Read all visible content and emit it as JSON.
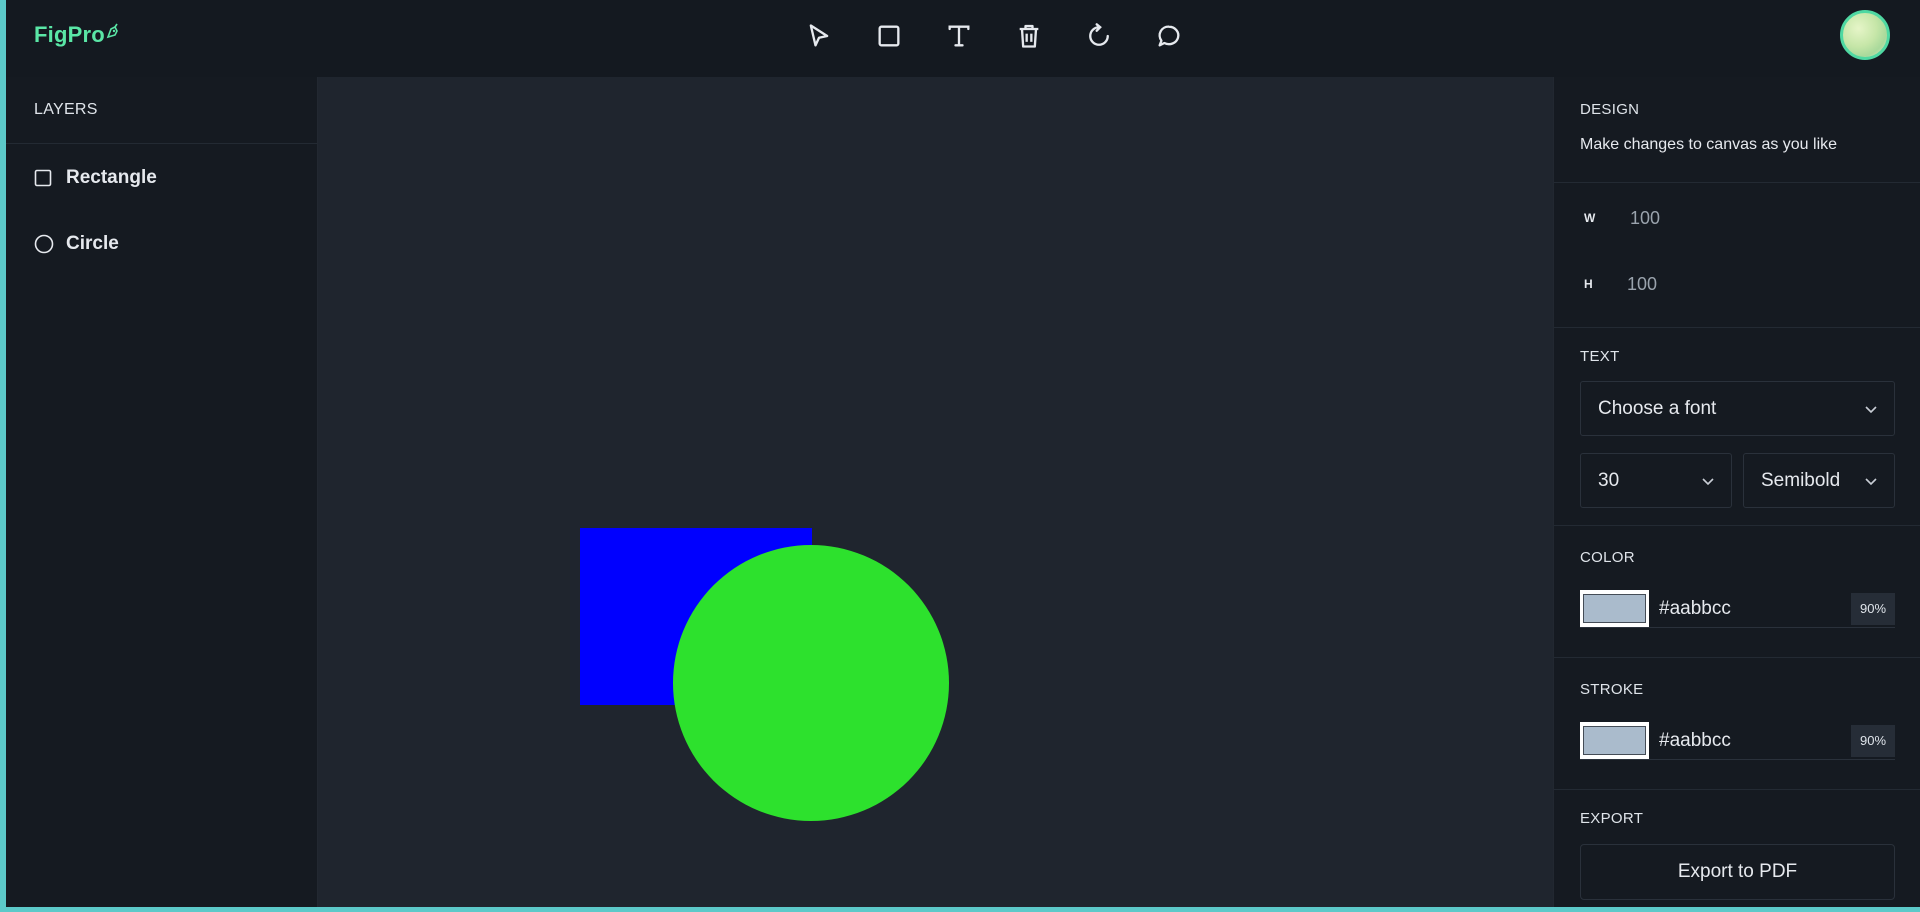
{
  "app": {
    "logo_text": "FigPro"
  },
  "toolbar": {
    "tools": [
      {
        "icon": "cursor-icon"
      },
      {
        "icon": "rectangle-icon"
      },
      {
        "icon": "text-icon"
      },
      {
        "icon": "trash-icon"
      },
      {
        "icon": "reset-icon"
      },
      {
        "icon": "comment-icon"
      }
    ]
  },
  "layers": {
    "title": "LAYERS",
    "items": [
      {
        "label": "Rectangle",
        "icon": "square-icon"
      },
      {
        "label": "Circle",
        "icon": "circle-icon"
      }
    ]
  },
  "canvas": {
    "shapes": [
      {
        "type": "rectangle",
        "fill": "#0000ff"
      },
      {
        "type": "circle",
        "fill": "#2de12d"
      }
    ]
  },
  "design": {
    "title": "DESIGN",
    "subtitle": "Make changes to canvas as you like",
    "width_label": "W",
    "width_value": "100",
    "height_label": "H",
    "height_value": "100"
  },
  "text": {
    "title": "TEXT",
    "font_family": "Choose a font",
    "font_size": "30",
    "font_weight": "Semibold"
  },
  "color": {
    "title": "COLOR",
    "hex": "#aabbcc",
    "opacity": "90%",
    "swatch": "#aabbcc"
  },
  "stroke": {
    "title": "STROKE",
    "hex": "#aabbcc",
    "opacity": "90%",
    "swatch": "#aabbcc"
  },
  "export": {
    "title": "EXPORT",
    "button_label": "Export to PDF"
  }
}
